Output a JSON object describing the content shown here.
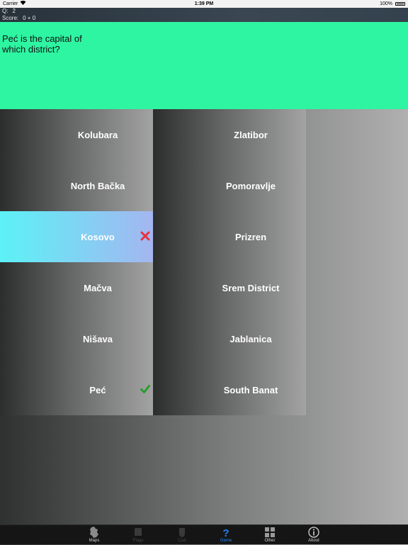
{
  "status_bar": {
    "carrier": "Carrier",
    "time": "1:39 PM",
    "battery": "100%"
  },
  "score_bar": {
    "question_label": "Q:",
    "question_value": "2",
    "score_label": "Score:",
    "score_value": "0 + 0"
  },
  "question": {
    "text": "Peć is the capital of which district?"
  },
  "answers": [
    {
      "label": "Kolubara",
      "state": "normal"
    },
    {
      "label": "Zlatibor",
      "state": "normal"
    },
    {
      "label": "North Bačka",
      "state": "normal"
    },
    {
      "label": "Pomoravlje",
      "state": "normal"
    },
    {
      "label": "Kosovo",
      "state": "wrong"
    },
    {
      "label": "Prizren",
      "state": "normal"
    },
    {
      "label": "Mačva",
      "state": "normal"
    },
    {
      "label": "Srem District",
      "state": "normal"
    },
    {
      "label": "Nišava",
      "state": "normal"
    },
    {
      "label": "Jablanica",
      "state": "normal"
    },
    {
      "label": "Peć",
      "state": "correct"
    },
    {
      "label": "South Banat",
      "state": "normal"
    }
  ],
  "tabs": [
    {
      "label": "Maps",
      "icon": "map-icon",
      "state": "normal"
    },
    {
      "label": "Flags",
      "icon": "flag-icon",
      "state": "disabled"
    },
    {
      "label": "CoA",
      "icon": "shield-icon",
      "state": "disabled"
    },
    {
      "label": "Game",
      "icon": "question-icon",
      "state": "active"
    },
    {
      "label": "Other",
      "icon": "grid-icon",
      "state": "normal"
    },
    {
      "label": "About",
      "icon": "info-icon",
      "state": "normal"
    }
  ],
  "colors": {
    "question_bg": "#2ef5a2",
    "wrong_mark": "#e8323c",
    "correct_mark": "#1fa02a",
    "active_tab": "#1a86ff"
  }
}
